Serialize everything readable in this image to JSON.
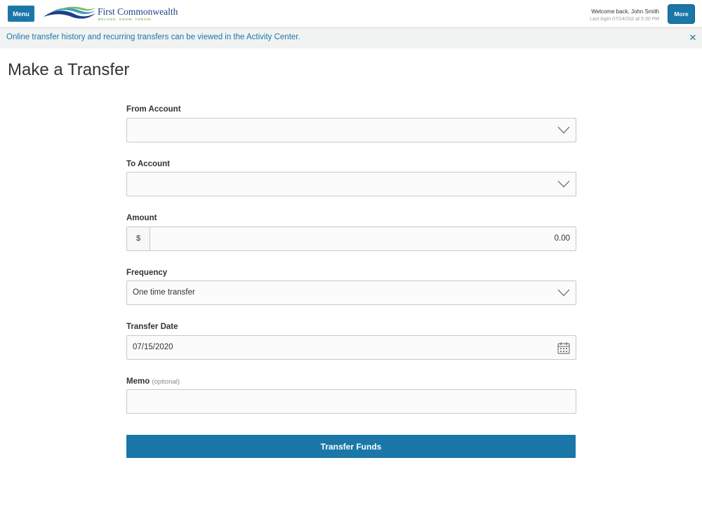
{
  "header": {
    "menu_label": "Menu",
    "logo_name": "First Commonwealth",
    "logo_tagline": "BELONG. GROW. THRIVE.",
    "welcome": "Welcome back, John Smith",
    "last_login": "Last login 07/14/202 at 5:30 PM",
    "more_label": "More"
  },
  "notice": {
    "text": "Online transfer history and recurring transfers can be viewed in the Activity Center.",
    "close_glyph": "✕"
  },
  "page_title": "Make a Transfer",
  "form": {
    "from_account": {
      "label": "From Account",
      "value": ""
    },
    "to_account": {
      "label": "To Account",
      "value": ""
    },
    "amount": {
      "label": "Amount",
      "prefix": "$",
      "value": "0.00"
    },
    "frequency": {
      "label": "Frequency",
      "value": "One time transfer"
    },
    "transfer_date": {
      "label": "Transfer Date",
      "value": "07/15/2020"
    },
    "memo": {
      "label": "Memo",
      "optional": "(optional)",
      "value": ""
    },
    "submit_label": "Transfer Funds"
  },
  "colors": {
    "primary": "#1a77a8",
    "logo_navy": "#1f3f86",
    "logo_green": "#7dbb55",
    "notice_bg": "#f1f2f2"
  },
  "icons": {
    "dropdown": "chevron-down-icon",
    "date": "calendar-icon",
    "close": "close-icon"
  }
}
